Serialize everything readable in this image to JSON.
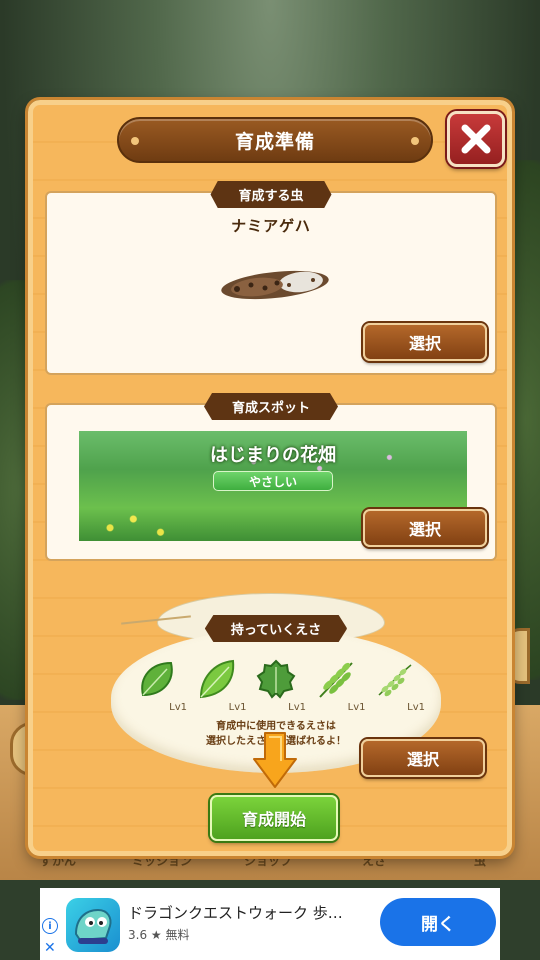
{
  "dialog": {
    "title": "育成準備",
    "close_icon": "close-x-icon"
  },
  "insect_section": {
    "tab_label": "育成する虫",
    "insect_name": "ナミアゲハ",
    "select_label": "選択"
  },
  "spot_section": {
    "tab_label": "育成スポット",
    "spot_name": "はじまりの花畑",
    "difficulty": "やさしい",
    "select_label": "選択"
  },
  "feed_section": {
    "tab_label": "持っていくえさ",
    "items": [
      {
        "name": "leaf-round",
        "level": "Lv1"
      },
      {
        "name": "leaf-oval",
        "level": "Lv1"
      },
      {
        "name": "leaf-serrated",
        "level": "Lv1"
      },
      {
        "name": "leaf-compound",
        "level": "Lv1"
      },
      {
        "name": "leaf-sprig",
        "level": "Lv1"
      }
    ],
    "note_line1": "育成中に使用できるえさは",
    "note_line2": "選択したえさから選ばれるよ！",
    "select_label": "選択"
  },
  "start_button_label": "育成開始",
  "background_nav": {
    "items": [
      "ずかん",
      "ミッション",
      "ショップ",
      "えさ",
      "虫"
    ]
  },
  "ad": {
    "title": "ドラゴンクエストウォーク 歩…",
    "rating": "3.6 ★ 無料",
    "open_label": "開く"
  },
  "colors": {
    "dialog_wood": "#f6b75c",
    "plate_brown": "#6f3c12",
    "close_red": "#c83a3a",
    "start_green": "#5bb527",
    "ad_blue": "#1a73e8"
  }
}
